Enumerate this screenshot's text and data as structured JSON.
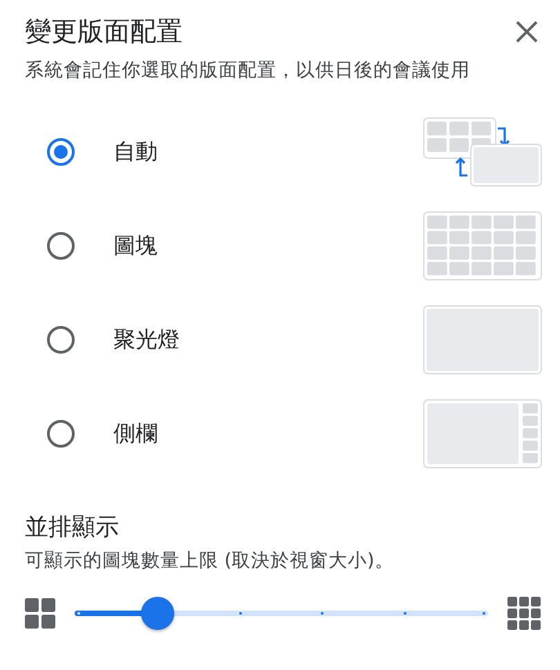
{
  "dialog": {
    "title": "變更版面配置",
    "subtitle": "系統會記住你選取的版面配置，以供日後的會議使用"
  },
  "layouts": [
    {
      "kind": "auto",
      "label": "自動",
      "selected": true
    },
    {
      "kind": "tiled",
      "label": "圖塊",
      "selected": false
    },
    {
      "kind": "spotlight",
      "label": "聚光燈",
      "selected": false
    },
    {
      "kind": "sidebar",
      "label": "側欄",
      "selected": false
    }
  ],
  "tiles": {
    "title": "並排顯示",
    "description": "可顯示的圖塊數量上限 (取決於視窗大小)。",
    "level": 0.2
  }
}
